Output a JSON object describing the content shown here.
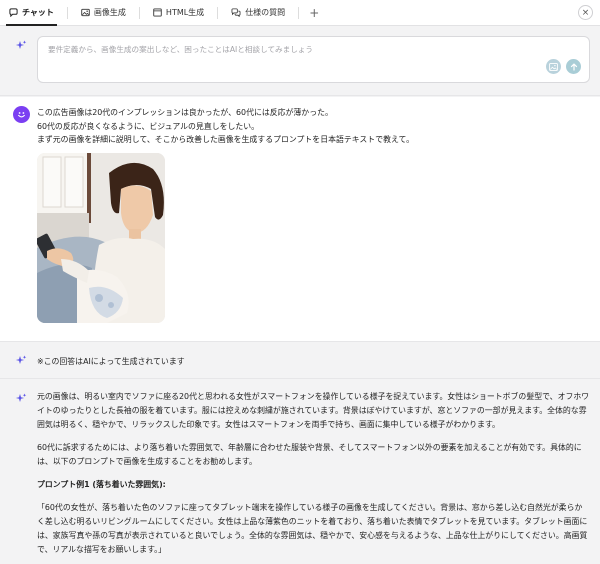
{
  "tabs": [
    {
      "label": "チャット",
      "icon": "chat-icon",
      "active": true
    },
    {
      "label": "画像生成",
      "icon": "image-icon",
      "active": false
    },
    {
      "label": "HTML生成",
      "icon": "html-icon",
      "active": false
    },
    {
      "label": "仕様の質問",
      "icon": "question-icon",
      "active": false
    }
  ],
  "tab_add": "+",
  "tab_close": "×",
  "input": {
    "placeholder": "要件定義から、画像生成の案出しなど、困ったことはAIと相談してみましょう"
  },
  "user_message": {
    "line1": "この広告画像は20代のインプレッションは良かったが、60代には反応が薄かった。",
    "line2": "60代の反応が良くなるように、ビジュアルの見直しをしたい。",
    "line3": "まず元の画像を詳細に説明して、そこから改善した画像を生成するプロンプトを日本語テキストで教えて。"
  },
  "ai_notice": "※この回答はAIによって生成されています",
  "answer": {
    "p1": "元の画像は、明るい室内でソファに座る20代と思われる女性がスマートフォンを操作している様子を捉えています。女性はショートボブの髪型で、オフホワイトのゆったりとした長袖の服を着ています。服には控えめな刺繍が施されています。背景はぼやけていますが、窓とソファの一部が見えます。全体的な雰囲気は明るく、穏やかで、リラックスした印象です。女性はスマートフォンを両手で持ち、画面に集中している様子がわかります。",
    "p2": "60代に訴求するためには、より落ち着いた雰囲気で、年齢層に合わせた服装や背景、そしてスマートフォン以外の要素を加えることが有効です。具体的には、以下のプロンプトで画像を生成することをお勧めします。",
    "heading": "プロンプト例1 (落ち着いた雰囲気):",
    "p3": "「60代の女性が、落ち着いた色のソファに座ってタブレット端末を操作している様子の画像を生成してください。背景は、窓から差し込む自然光が柔らかく差し込む明るいリビングルームにしてください。女性は上品な薄紫色のニットを着ており、落ち着いた表情でタブレットを見ています。タブレット画面には、家族写真や孫の写真が表示されていると良いでしょう。全体的な雰囲気は、穏やかで、安心感を与えるような、上品な仕上がりにしてください。高画質で、リアルな描写をお願いします。」"
  },
  "colors": {
    "avatar": "#7b3ff2",
    "sparkle": "#5b55e6",
    "send_button": "#a9cdd6"
  }
}
